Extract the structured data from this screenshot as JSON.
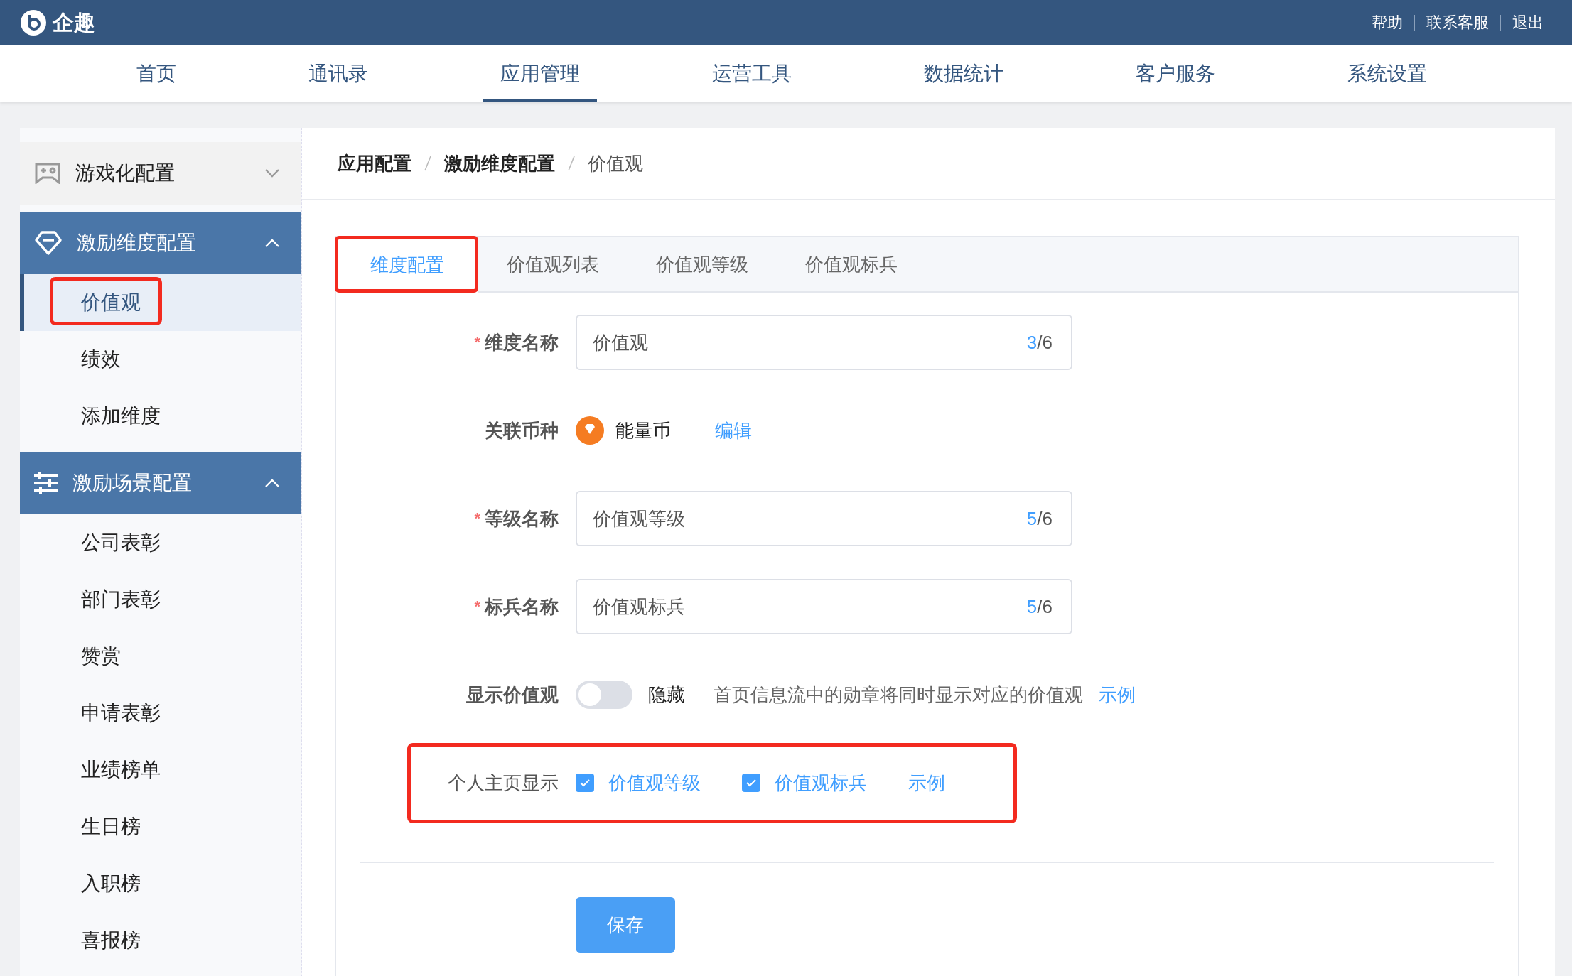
{
  "header": {
    "logo": "企趣",
    "links": [
      "帮助",
      "联系客服",
      "退出"
    ]
  },
  "nav": [
    {
      "label": "首页",
      "selected": false
    },
    {
      "label": "通讯录",
      "selected": false
    },
    {
      "label": "应用管理",
      "selected": true
    },
    {
      "label": "运营工具",
      "selected": false
    },
    {
      "label": "数据统计",
      "selected": false
    },
    {
      "label": "客户服务",
      "selected": false
    },
    {
      "label": "系统设置",
      "selected": false
    }
  ],
  "sidebar": {
    "groups": [
      {
        "kind": "gamepad",
        "label": "游戏化配置",
        "expanded": false
      },
      {
        "kind": "diamond",
        "label": "激励维度配置",
        "expanded": true,
        "items": [
          {
            "label": "价值观",
            "selected": true,
            "annotated": true
          },
          {
            "label": "绩效",
            "selected": false,
            "annotated": false
          },
          {
            "label": "添加维度",
            "selected": false,
            "annotated": false
          }
        ]
      },
      {
        "kind": "sliders",
        "label": "激励场景配置",
        "expanded": true,
        "items": [
          {
            "label": "公司表彰",
            "selected": false,
            "annotated": false
          },
          {
            "label": "部门表彰",
            "selected": false,
            "annotated": false
          },
          {
            "label": "赞赏",
            "selected": false,
            "annotated": false
          },
          {
            "label": "申请表彰",
            "selected": false,
            "annotated": false
          },
          {
            "label": "业绩榜单",
            "selected": false,
            "annotated": false
          },
          {
            "label": "生日榜",
            "selected": false,
            "annotated": false
          },
          {
            "label": "入职榜",
            "selected": false,
            "annotated": false
          },
          {
            "label": "喜报榜",
            "selected": false,
            "annotated": false
          }
        ]
      }
    ]
  },
  "breadcrumb": [
    "应用配置",
    "激励维度配置",
    "价值观"
  ],
  "tabs": [
    {
      "label": "维度配置",
      "selected": true,
      "annotated": true
    },
    {
      "label": "价值观列表",
      "selected": false,
      "annotated": false
    },
    {
      "label": "价值观等级",
      "selected": false,
      "annotated": false
    },
    {
      "label": "价值观标兵",
      "selected": false,
      "annotated": false
    }
  ],
  "form": [
    {
      "kind": "input",
      "mark": "*",
      "label": "维度名称",
      "value": "价值观",
      "count": "3",
      "limit": "/6",
      "annotated": false
    },
    {
      "kind": "currency",
      "label": "关联币种",
      "currency": "能量币",
      "action": "编辑",
      "annotated": false
    },
    {
      "kind": "input",
      "mark": "*",
      "label": "等级名称",
      "value": "价值观等级",
      "count": "5",
      "limit": "/6",
      "annotated": false
    },
    {
      "kind": "input",
      "mark": "*",
      "label": "标兵名称",
      "value": "价值观标兵",
      "count": "5",
      "limit": "/6",
      "annotated": false
    },
    {
      "kind": "toggle",
      "label": "显示价值观",
      "on": false,
      "state_text": "隐藏",
      "hint": "首页信息流中的勋章将同时显示对应的价值观",
      "link": "示例",
      "annotated": false
    },
    {
      "kind": "checks",
      "label": "个人主页显示",
      "options": [
        {
          "label": "价值观等级",
          "checked": true
        },
        {
          "label": "价值观标兵",
          "checked": true
        }
      ],
      "link": "示例",
      "annotated": true
    }
  ],
  "save_button": "保存"
}
